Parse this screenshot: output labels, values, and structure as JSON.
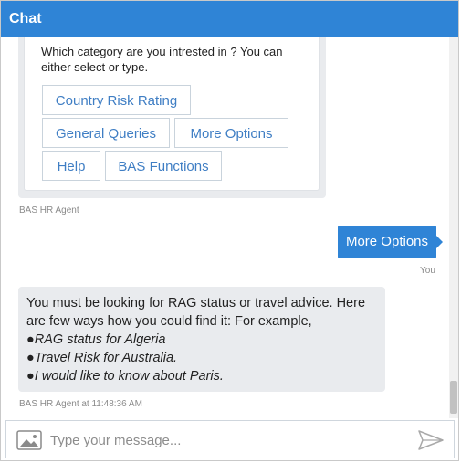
{
  "header": {
    "title": "Chat"
  },
  "card": {
    "prompt": "Which category are you intrested in ? You can either select or type.",
    "options": [
      "Country Risk Rating",
      "General Queries",
      "More Options",
      "Help",
      "BAS Functions"
    ]
  },
  "card_sender": "BAS HR Agent",
  "user_message": {
    "text": "More Options",
    "sender": "You"
  },
  "bot_message": {
    "lines": [
      "You must be looking for RAG status or travel advice. Here",
      "are few ways how you could find it: For example,",
      "●RAG status for Algeria",
      "●Travel Risk for Australia.",
      "●I would like to know about Paris."
    ],
    "meta": "BAS HR Agent at 11:48:36 AM"
  },
  "composer": {
    "placeholder": "Type your message..."
  },
  "icons": {
    "image": "image-icon",
    "send": "send-icon"
  },
  "colors": {
    "header": "#2f84d6",
    "user_bubble": "#2f84d6",
    "bot_bubble": "#e9ebee",
    "option_text": "#3f7ec4"
  }
}
